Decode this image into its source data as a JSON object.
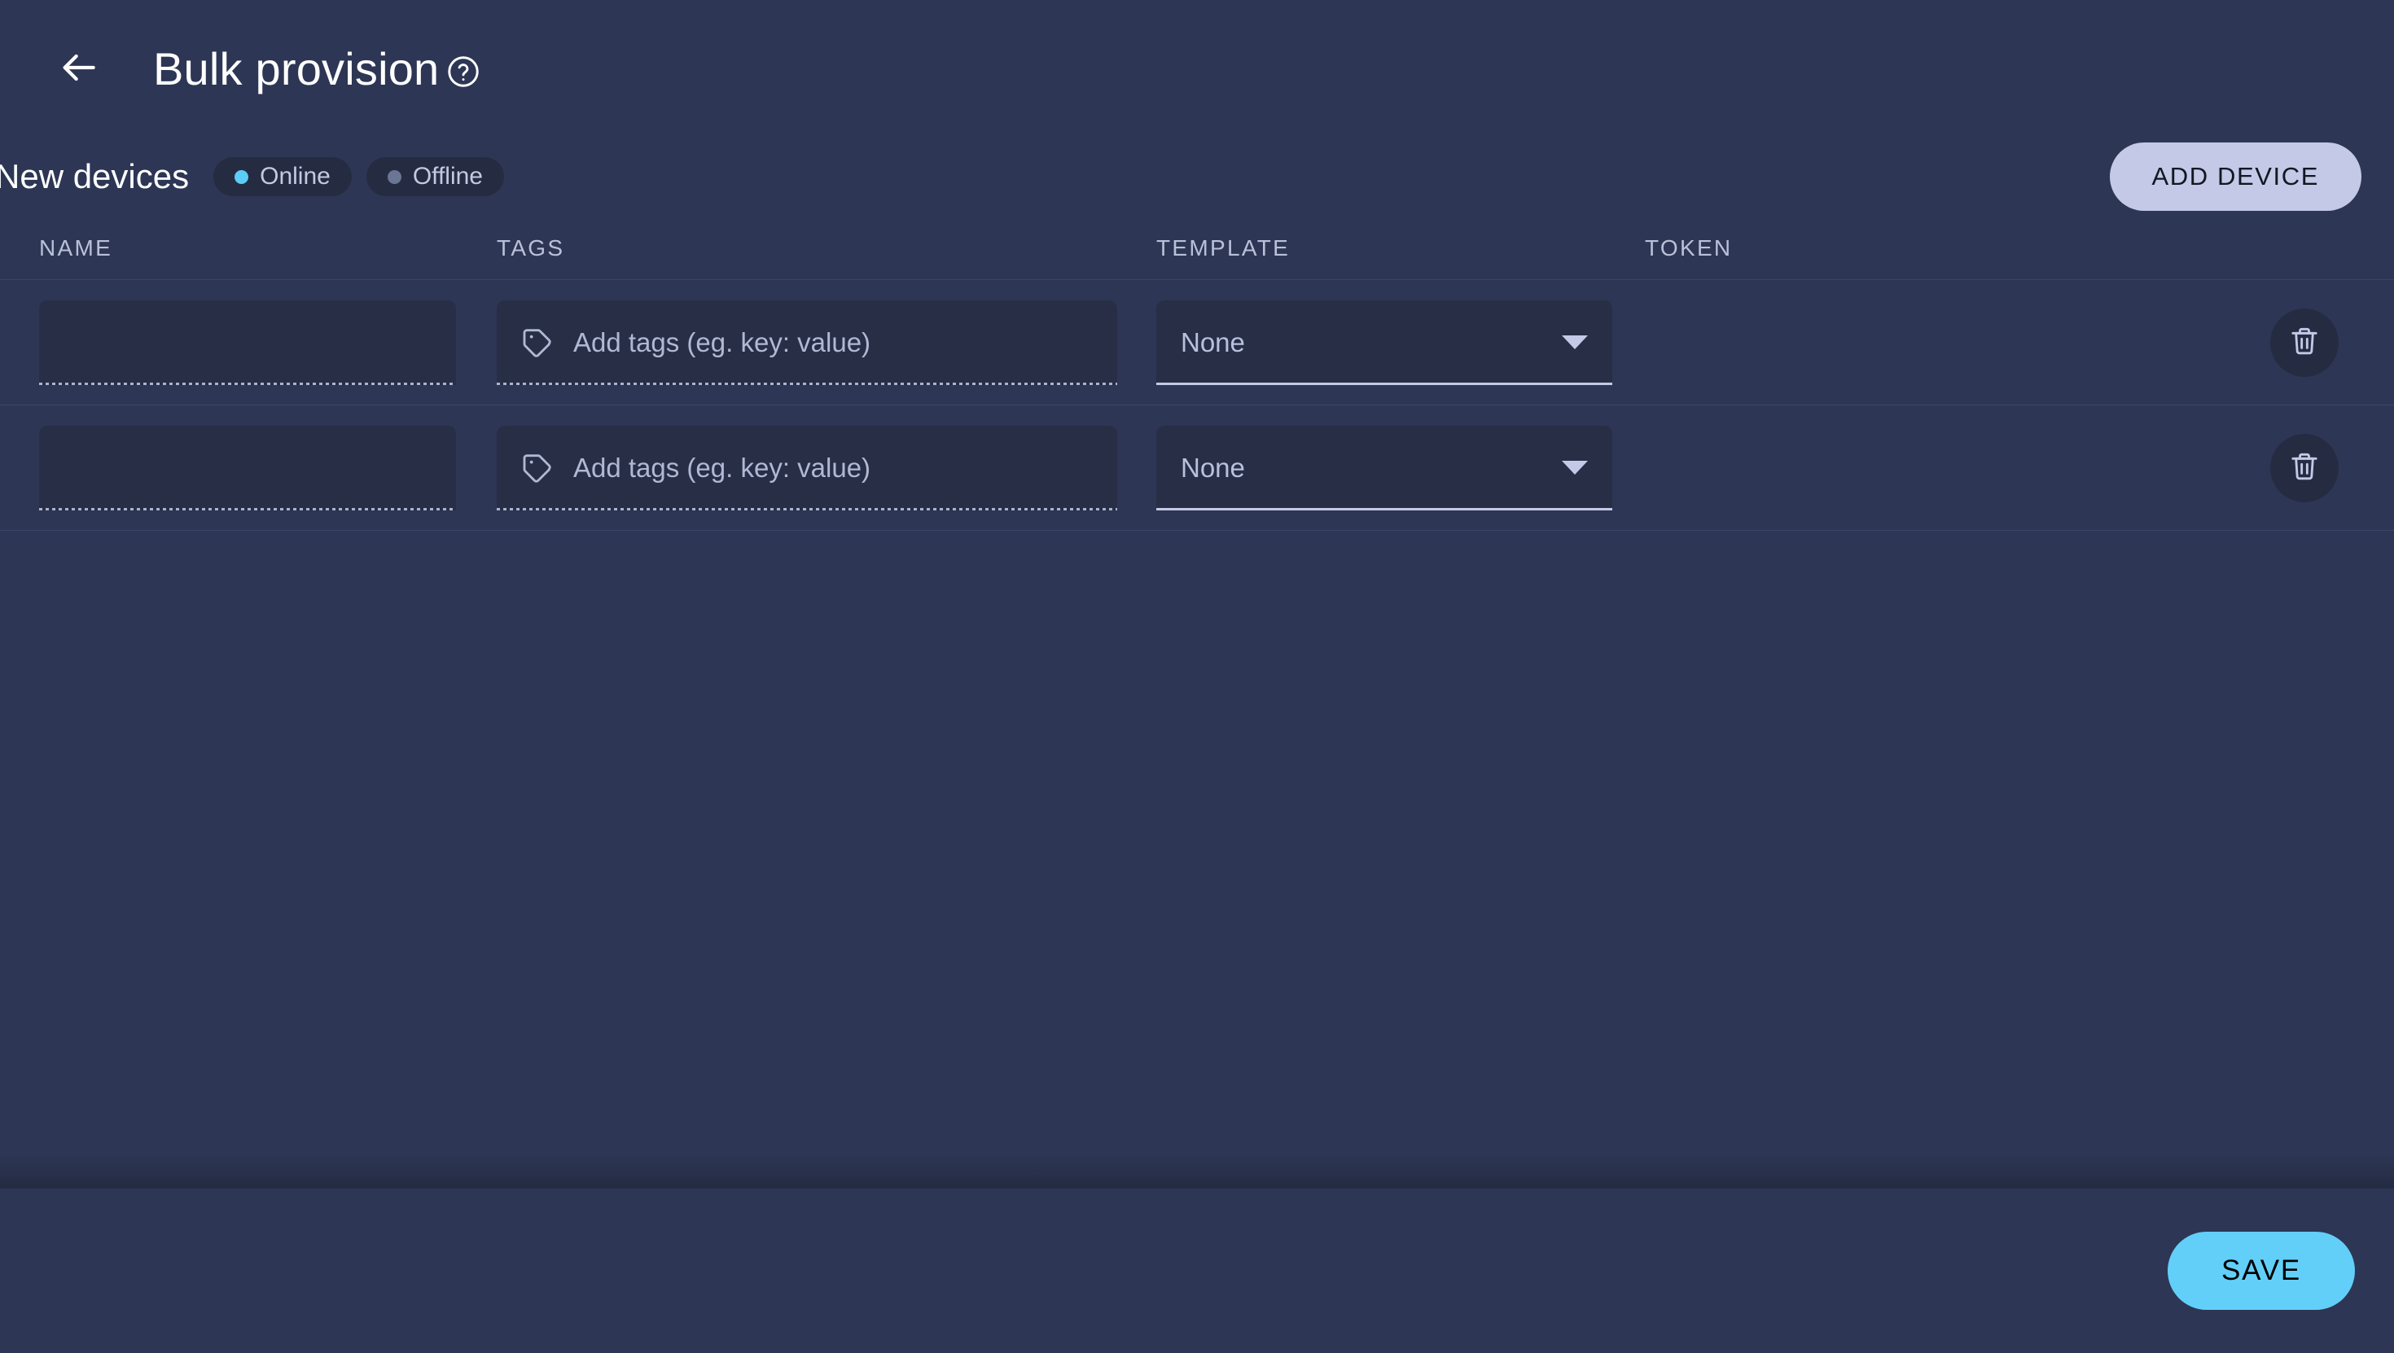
{
  "header": {
    "back_icon": "arrow-left-icon",
    "title": "Bulk provision",
    "help_icon": "help-circle-icon"
  },
  "subheader": {
    "section_title": "New devices",
    "chips": [
      {
        "label": "Online",
        "dot_color": "#5bcdf7"
      },
      {
        "label": "Offline",
        "dot_color": "#6b7694"
      }
    ],
    "add_device_label": "ADD DEVICE"
  },
  "table": {
    "columns": [
      "NAME",
      "TAGS",
      "TEMPLATE",
      "TOKEN"
    ],
    "name_placeholder": "",
    "tags_placeholder": "Add tags (eg. key: value)",
    "tags_icon": "tag-icon",
    "template_caret_icon": "chevron-down-icon",
    "delete_icon": "trash-icon",
    "rows": [
      {
        "name": "",
        "tags": "Add tags (eg. key: value)",
        "template": "None",
        "token": ""
      },
      {
        "name": "",
        "tags": "Add tags (eg. key: value)",
        "template": "None",
        "token": ""
      }
    ]
  },
  "footer": {
    "save_label": "SAVE"
  },
  "colors": {
    "background": "#2d3654",
    "field_background": "#272e45",
    "chip_background": "#252c42",
    "accent_cyan": "#62cff9",
    "accent_lavender": "#c3c9e6",
    "divider": "#3c456a",
    "muted_text": "#b9c0d8"
  }
}
